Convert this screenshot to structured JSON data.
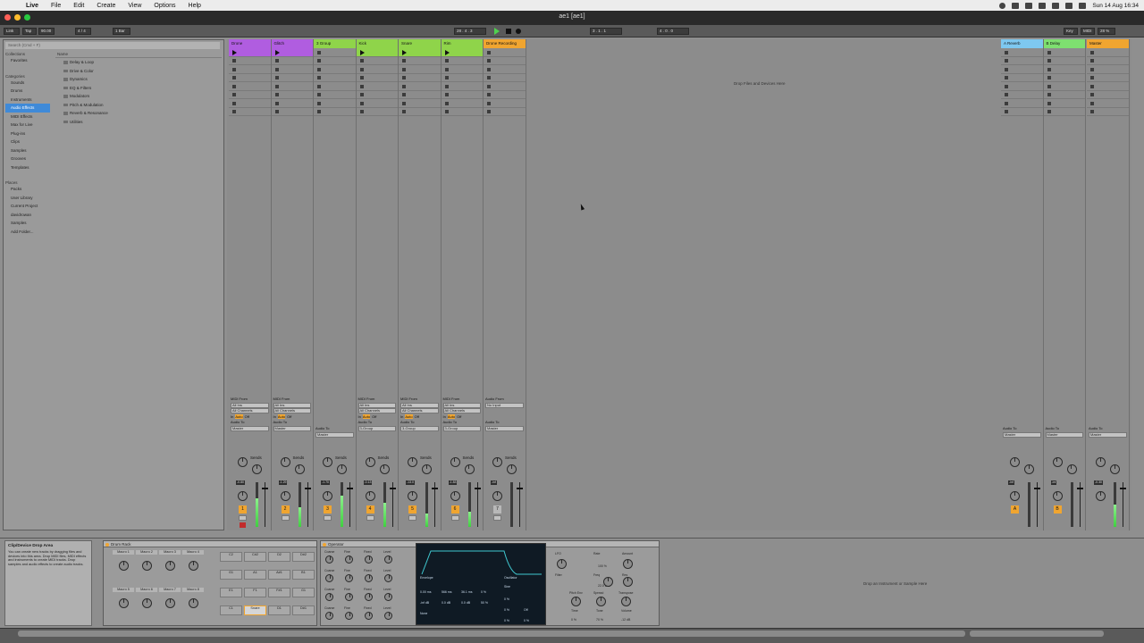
{
  "menubar": {
    "app": "Live",
    "items": [
      "File",
      "Edit",
      "Create",
      "View",
      "Options",
      "Help"
    ],
    "clock": "Sun 14 Aug 16:34"
  },
  "window": {
    "title": "ae1 [ae1]"
  },
  "transport": {
    "link": "Link",
    "tap": "Tap",
    "tempo": "90.00",
    "signature": "4 / 4",
    "quantize": "1 Bar",
    "position": "28 . 4 . 3",
    "loop_start": "3 . 1 . 1",
    "loop_length": "4 . 0 . 0",
    "key": "Key",
    "midi": "MIDI",
    "cpu": "28 %"
  },
  "browser": {
    "search_placeholder": "Search (Cmd + F)",
    "collections_label": "Collections",
    "favorites": "Favorites",
    "categories_label": "Categories",
    "categories": [
      "Sounds",
      "Drums",
      "Instruments",
      "Audio Effects",
      "MIDI Effects",
      "Max for Live",
      "Plug-ins",
      "Clips",
      "Samples",
      "Grooves",
      "Templates"
    ],
    "selected_category": "Audio Effects",
    "places_label": "Places",
    "places": [
      "Packs",
      "User Library",
      "Current Project",
      "davidrowan",
      "Samples",
      "Add Folder..."
    ],
    "name_header": "Name",
    "folders": [
      "Delay & Loop",
      "Drive & Color",
      "Dynamics",
      "EQ & Filters",
      "Modulators",
      "Pitch & Modulation",
      "Reverb & Resonance",
      "Utilities"
    ]
  },
  "colors": {
    "accent": "#f0a530",
    "selection": "#3f8ad8",
    "meter": "#3fd03f"
  },
  "tracks": [
    {
      "name": "Drone",
      "color": "#b05de0",
      "num": "1",
      "type": "midi",
      "send_label": "Sends",
      "volume": "-0.80",
      "meter": 0.65,
      "armed": true
    },
    {
      "name": "Glitch",
      "color": "#b05de0",
      "num": "2",
      "type": "midi",
      "send_label": "Sends",
      "volume": "-1.29",
      "meter": 0.45,
      "armed": false
    },
    {
      "name": "3 Group",
      "color": "#8fd44a",
      "num": "3",
      "type": "group",
      "send_label": "Sends",
      "volume": "-1.70",
      "meter": 0.7,
      "armed": false
    },
    {
      "name": "Kick",
      "color": "#8fd44a",
      "num": "4",
      "type": "midi",
      "send_label": "Sends",
      "volume": "-0.13",
      "meter": 0.55,
      "armed": false
    },
    {
      "name": "Snare",
      "color": "#8fd44a",
      "num": "5",
      "type": "midi",
      "send_label": "Sends",
      "volume": "-13.0",
      "meter": 0.3,
      "armed": false
    },
    {
      "name": "Rim",
      "color": "#8fd44a",
      "num": "6",
      "type": "midi",
      "send_label": "Sends",
      "volume": "-1.83",
      "meter": 0.35,
      "armed": false
    },
    {
      "name": "Drone Recording",
      "color": "#f0a530",
      "num": "7",
      "type": "audio",
      "send_label": "Sends",
      "volume": "-inf",
      "meter": 0.0,
      "armed": false
    }
  ],
  "returns": [
    {
      "name": "A Reverb",
      "color": "#7ec8f0",
      "letter": "A",
      "volume": "-inf"
    },
    {
      "name": "B Delay",
      "color": "#7ee070",
      "letter": "B",
      "volume": "-inf"
    }
  ],
  "master": {
    "name": "Master",
    "color": "#f0a530",
    "volume": "-0.30",
    "cue_out": "Cue Out",
    "master_out": "Master Out",
    "cue_value": "1/2"
  },
  "io_labels": {
    "midi_from": "MIDI From",
    "all_ins": "All Ins",
    "all_channels": "All Channels",
    "monitor_in": "In",
    "monitor_auto": "Auto",
    "monitor_off": "Off",
    "audio_to": "Audio To",
    "master": "Master",
    "group3": "3-Group",
    "audio_from": "Audio From",
    "no_input": "No Input"
  },
  "session_drop": "Drop Files and Devices Here",
  "device_drop": "Drop an Instrument or Sample Here",
  "info": {
    "title": "Clip/Device Drop Area",
    "text": "You can create new tracks by dragging files and devices into this area. Drop MIDI files, MIDI effects and instruments to create MIDI tracks. Drop samples and audio effects to create audio tracks."
  },
  "drum_rack": {
    "title": "Drum Rack",
    "macros": [
      "Macro 1",
      "Macro 2",
      "Macro 3",
      "Macro 4",
      "Macro 5",
      "Macro 6",
      "Macro 7",
      "Macro 8"
    ],
    "pads": [
      "C2",
      "C#2",
      "D2",
      "D#2",
      "G1",
      "A1",
      "A#1",
      "B1",
      "E1",
      "F1",
      "F#1",
      "G1",
      "C1",
      "Snare",
      "D1",
      "D#1"
    ],
    "selected_pad": "Snare"
  },
  "operator": {
    "title": "Operator",
    "osc_labels": [
      "Coarse",
      "Fine",
      "Fixed",
      "Level"
    ],
    "envelope": {
      "label": "Envelope",
      "attack": "0.00 ms",
      "decay": "566 ms",
      "release": "36.1 ms",
      "time_vel": "0 %",
      "initial": "-inf dB",
      "peak": "0.0 dB",
      "sustain": "0.0 dB",
      "vel": "50 %",
      "loop": "None"
    },
    "oscillator": {
      "label": "Oscillator",
      "wave": "Sine",
      "feedback": "0 %",
      "phase": "0 %",
      "repeat": "Off",
      "key": "0 %",
      "osc_vel": "0 %"
    },
    "lfo": {
      "label": "LFO",
      "rate": "Rate",
      "amount": "Amount",
      "rate_val": "100 %"
    },
    "filter": {
      "label": "Filter",
      "freq": "Freq",
      "res": "Res",
      "freq_val": "22.0 kHz"
    },
    "global": {
      "pitch_env": "Pitch Env",
      "spread": "Spread",
      "transpose": "Transpose",
      "time": "Time",
      "tone": "Tone",
      "volume": "Volume",
      "time_val": "0 %",
      "tone_val": "70 %",
      "volume_val": "-12 dB"
    }
  }
}
